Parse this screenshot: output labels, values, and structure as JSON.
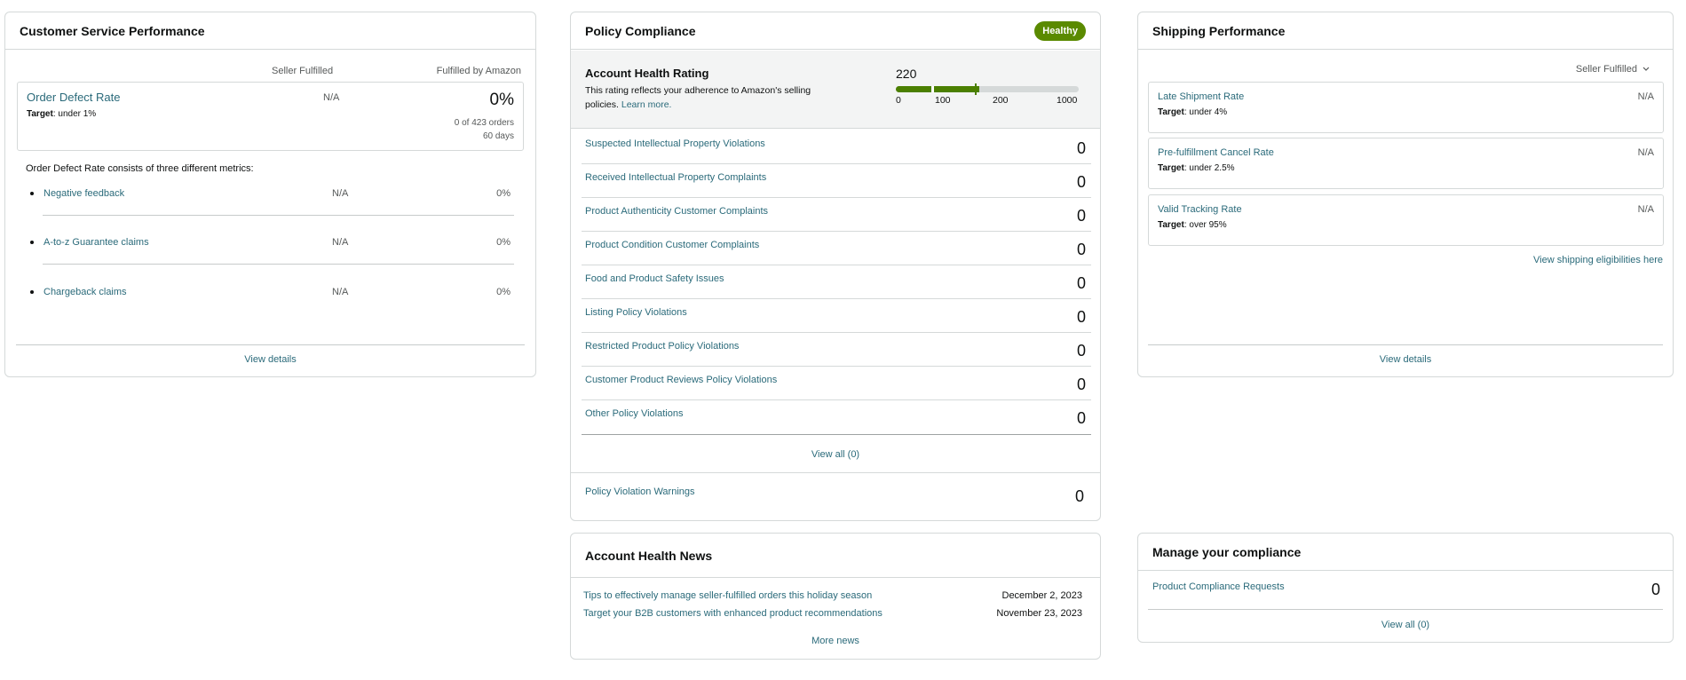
{
  "csp": {
    "title": "Customer Service Performance",
    "col_seller": "Seller Fulfilled",
    "col_fba": "Fulfilled by Amazon",
    "odr": {
      "label": "Order Defect Rate",
      "target_prefix": "Target",
      "target": ": under 1%",
      "seller_value": "N/A",
      "fba_value": "0%",
      "fba_orders": "0 of 423 orders",
      "fba_days": "60 days"
    },
    "consists": "Order Defect Rate consists of three different metrics:",
    "metrics": [
      {
        "label": "Negative feedback",
        "seller": "N/A",
        "fba": "0%"
      },
      {
        "label": "A-to-z Guarantee claims",
        "seller": "N/A",
        "fba": "0%"
      },
      {
        "label": "Chargeback claims",
        "seller": "N/A",
        "fba": "0%"
      }
    ],
    "view_details": "View details"
  },
  "policy": {
    "title": "Policy Compliance",
    "badge": "Healthy",
    "badge_color": "#5a8a00",
    "ahr": {
      "title": "Account Health Rating",
      "description": "This rating reflects your adherence to Amazon's selling policies.",
      "learn_more": "Learn more.",
      "score": "220",
      "score_value": 220,
      "scale_max": 1000,
      "ticks": [
        "0",
        "100",
        "200",
        "1000"
      ]
    },
    "rows": [
      {
        "label": "Suspected Intellectual Property Violations",
        "value": "0"
      },
      {
        "label": "Received Intellectual Property Complaints",
        "value": "0"
      },
      {
        "label": "Product Authenticity Customer Complaints",
        "value": "0"
      },
      {
        "label": "Product Condition Customer Complaints",
        "value": "0"
      },
      {
        "label": "Food and Product Safety Issues",
        "value": "0"
      },
      {
        "label": "Listing Policy Violations",
        "value": "0"
      },
      {
        "label": "Restricted Product Policy Violations",
        "value": "0"
      },
      {
        "label": "Customer Product Reviews Policy Violations",
        "value": "0"
      },
      {
        "label": "Other Policy Violations",
        "value": "0"
      }
    ],
    "view_all": "View all (0)",
    "warnings_label": "Policy Violation Warnings",
    "warnings_value": "0"
  },
  "shipping": {
    "title": "Shipping Performance",
    "filter": "Seller Fulfilled",
    "rows": [
      {
        "label": "Late Shipment Rate",
        "target": ": under 4%",
        "value": "N/A"
      },
      {
        "label": "Pre-fulfillment Cancel Rate",
        "target": ": under 2.5%",
        "value": "N/A"
      },
      {
        "label": "Valid Tracking Rate",
        "target": ": over 95%",
        "value": "N/A"
      }
    ],
    "target_prefix": "Target",
    "eligibilities": "View shipping eligibilities here",
    "view_details": "View details"
  },
  "news": {
    "title": "Account Health News",
    "items": [
      {
        "label": "Tips to effectively manage seller-fulfilled orders this holiday season",
        "date": "December 2, 2023"
      },
      {
        "label": "Target your B2B customers with enhanced product recommendations",
        "date": "November 23, 2023"
      }
    ],
    "more": "More news"
  },
  "manage": {
    "title": "Manage your compliance",
    "row_label": "Product Compliance Requests",
    "row_value": "0",
    "view_all": "View all (0)"
  },
  "icons": {
    "chevron": "chevron-down-icon"
  }
}
